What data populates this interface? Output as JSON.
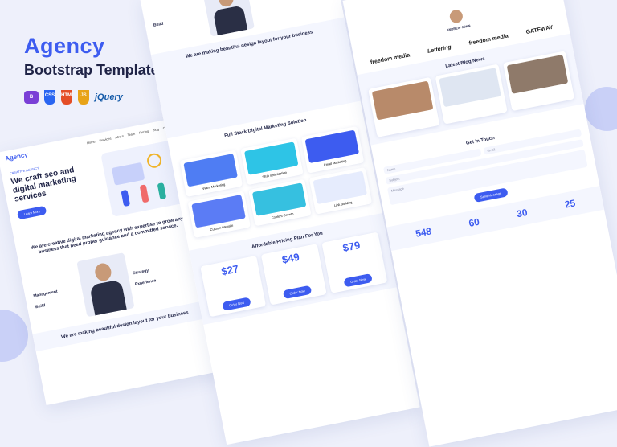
{
  "brand": {
    "logo": "Agency",
    "subtitle": "Bootstrap Template"
  },
  "tech": [
    "Bootstrap",
    "CSS3",
    "HTML5",
    "JS",
    "jQuery"
  ],
  "tech_labels": {
    "css": "CSS",
    "html": "HTML",
    "js": "JS",
    "jquery": "jQuery"
  },
  "nav": {
    "brand": "Agency",
    "links": [
      "Home",
      "Services",
      "About",
      "Team",
      "Pricing",
      "Blog",
      "Contact"
    ]
  },
  "p1": {
    "tag": "CREATIVE AGENCY",
    "hero_title": "We craft seo and digital marketing services",
    "hero_btn": "Learn More",
    "about": "We are creative digital marketing agency with expertise to grow any business that need proper guidance and a committed service.",
    "features": [
      "Strategy",
      "Management",
      "Experience",
      "Build"
    ],
    "design_heading": "We are making beautiful design layout for your business"
  },
  "p2": {
    "build": "Build",
    "design_heading": "We are making beautiful design layout for your business",
    "services_heading": "Full Stack Digital Marketing Solution",
    "services": [
      "Video Marketing",
      "SEO optimization",
      "Email Marketing",
      "Custom Website",
      "Content Growth",
      "Link Building"
    ],
    "pricing_heading": "Affordable Pricing Plan For You",
    "prices": [
      "27",
      "49",
      "79"
    ],
    "price_btn": "Order Now"
  },
  "p3": {
    "testimonial_name": "ANDREW JOHN",
    "logos": [
      "freedom media",
      "Lettering",
      "freedom media",
      "GATEWAY"
    ],
    "blog_heading": "Latest Blog News",
    "contact_heading": "Get In Touch",
    "contact_fields": [
      "Name",
      "Email",
      "Subject",
      "Message"
    ],
    "contact_btn": "Send Message",
    "stats": [
      "548",
      "60",
      "30",
      "25"
    ]
  }
}
